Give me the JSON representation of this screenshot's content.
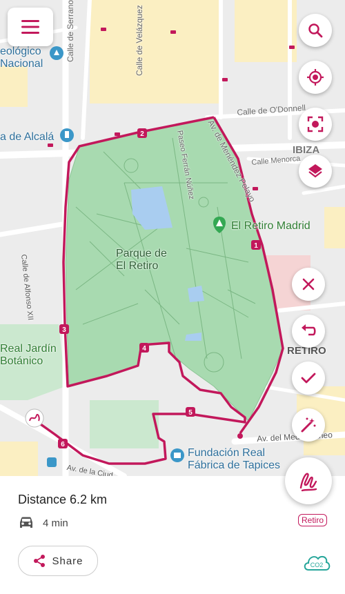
{
  "map": {
    "labels": {
      "museo": "eológico\nNacional",
      "serrano": "Calle de Serrano",
      "velazquez": "Calle de Velázquez",
      "odonnell": "Calle de O'Donnell",
      "menendez": "Av. de Menéndez Pelayo",
      "ferran": "Paseo Ferrán Núñez",
      "ibiza": "IBIZA",
      "menorca": "Calle Menorca",
      "alcala": "a de Alcalá",
      "retiro_madrid": "El Retiro Madrid",
      "parque": "Parque de\nEl Retiro",
      "alfonso": "Calle de Alfonso XII",
      "jardin": "Real Jardín\nBotánico",
      "retiro": "RETIRO",
      "mediterraneo": "Av. del Mediterráneo",
      "fundacion": "Fundación Real\nFábrica de Tapices",
      "ciudad": "Av. de la Ciud"
    },
    "waypoints": [
      "1",
      "2",
      "3",
      "4",
      "5",
      "6"
    ],
    "route_color": "#c2185b",
    "park_color": "#a8dab0"
  },
  "controls": {
    "menu": "menu-icon",
    "search": "search-icon",
    "locate": "locate-icon",
    "fit": "fit-screen-icon",
    "layers": "layers-icon",
    "close": "close-icon",
    "undo": "undo-icon",
    "confirm": "check-icon",
    "magic": "magic-wand-icon",
    "draw": "freehand-draw-icon"
  },
  "summary": {
    "distance": "Distance 6.2 km",
    "duration": "4 min",
    "mode_icon": "car-icon",
    "share_label": "Share",
    "area_tag": "Retiro",
    "co2_label": "CO2"
  }
}
